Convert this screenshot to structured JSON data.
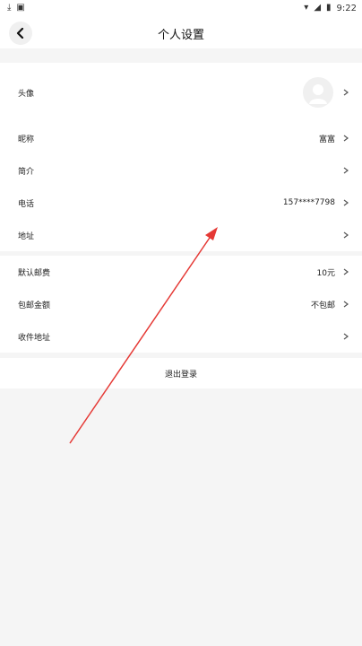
{
  "status": {
    "time": "9:22",
    "icons_left": [
      "download-icon",
      "gallery-icon"
    ],
    "icons_right": [
      "wifi-icon",
      "signal-icon",
      "battery-icon"
    ]
  },
  "header": {
    "title": "个人设置"
  },
  "profile": {
    "avatar_label": "头像",
    "nickname_label": "昵称",
    "nickname_value": "富富",
    "bio_label": "简介",
    "phone_label": "电话",
    "phone_value": "157****7798",
    "address_label": "地址"
  },
  "shipping": {
    "default_postage_label": "默认邮费",
    "default_postage_value": "10元",
    "free_shipping_amount_label": "包邮金额",
    "free_shipping_amount_value": "不包邮",
    "receiving_address_label": "收件地址"
  },
  "actions": {
    "logout_label": "退出登录"
  },
  "colors": {
    "annotation_arrow": "#e53935",
    "background": "#f5f5f5"
  }
}
